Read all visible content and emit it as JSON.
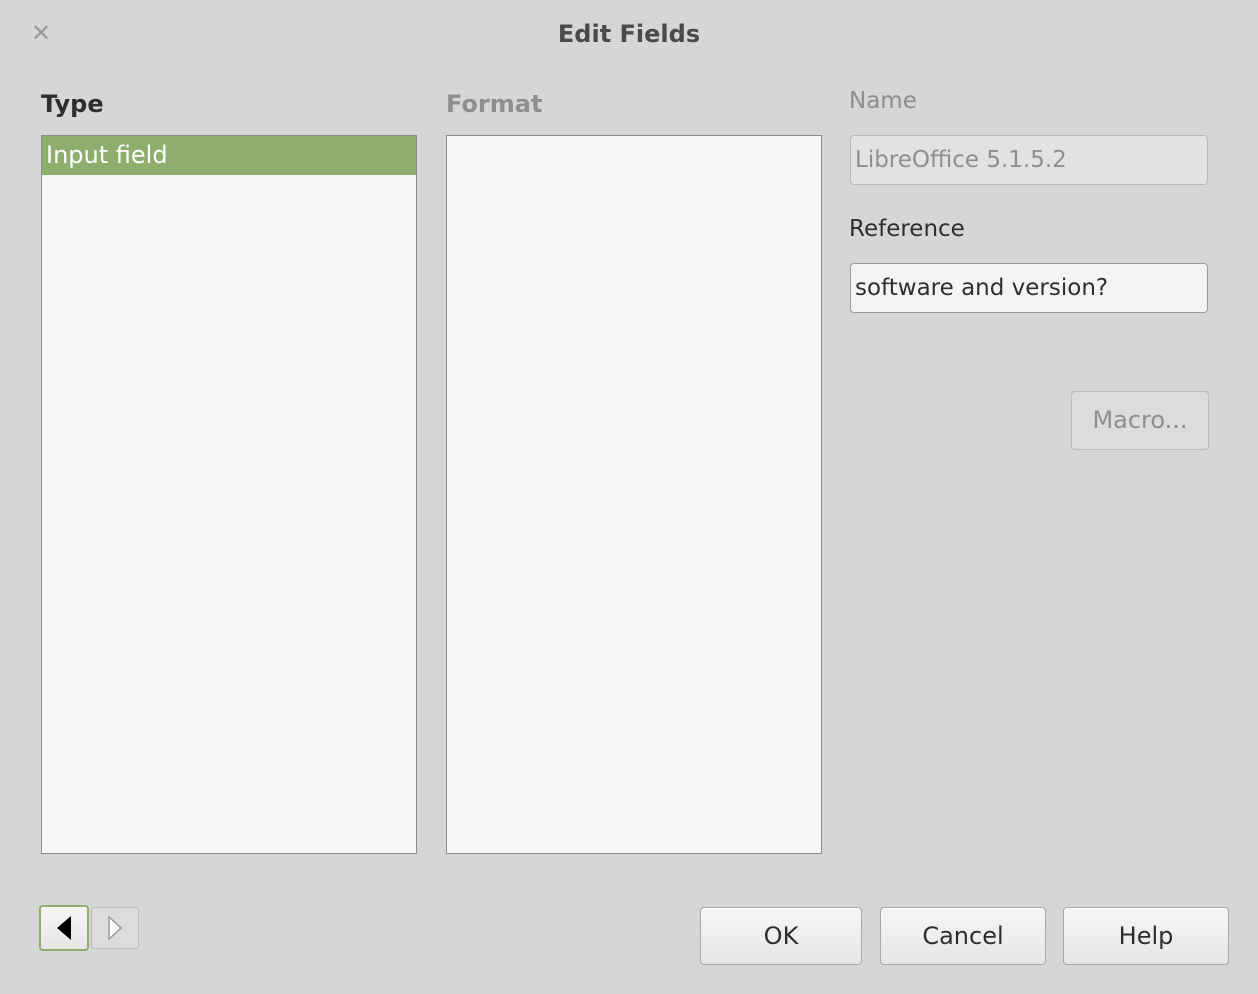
{
  "window": {
    "title": "Edit Fields",
    "close_icon": "close-icon"
  },
  "type_column": {
    "label": "Type",
    "items": [
      {
        "label": "Input field",
        "selected": true
      }
    ]
  },
  "format_column": {
    "label": "Format",
    "items": []
  },
  "name_field": {
    "label": "Name",
    "value": "LibreOffice 5.1.5.2",
    "disabled": true
  },
  "reference_field": {
    "label": "Reference",
    "value": "software and version?"
  },
  "buttons": {
    "macro": "Macro...",
    "ok": "OK",
    "cancel": "Cancel",
    "help": "Help"
  },
  "navigation": {
    "prev_icon": "arrow-left-icon",
    "next_icon": "arrow-right-icon"
  },
  "colors": {
    "selection": "#8fae6e",
    "background": "#d6d6d6"
  }
}
